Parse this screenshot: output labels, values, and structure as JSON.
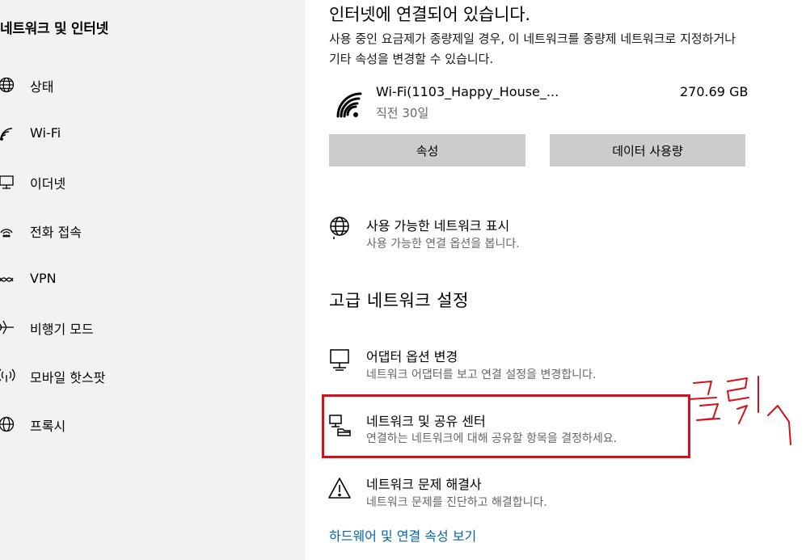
{
  "sidebar": {
    "title": "네트워크 및 인터넷",
    "items": [
      {
        "label": "상태",
        "icon": "globe-icon"
      },
      {
        "label": "Wi-Fi",
        "icon": "wifi-icon"
      },
      {
        "label": "이더넷",
        "icon": "ethernet-icon"
      },
      {
        "label": "전화 접속",
        "icon": "dialup-icon"
      },
      {
        "label": "VPN",
        "icon": "vpn-icon"
      },
      {
        "label": "비행기 모드",
        "icon": "airplane-icon"
      },
      {
        "label": "모바일 핫스팟",
        "icon": "hotspot-icon"
      },
      {
        "label": "프록시",
        "icon": "globe-icon"
      }
    ]
  },
  "status": {
    "heading": "인터넷에 연결되어 있습니다.",
    "description": "사용 중인 요금제가 종량제일 경우, 이 네트워크를 종량제 네트워크로 지정하거나 기타 속성을 변경할 수 있습니다."
  },
  "connection": {
    "name": "Wi-Fi(1103_Happy_House_...",
    "subtitle": "직전 30일",
    "usage": "270.69 GB",
    "icon": "wifi-signal-icon"
  },
  "buttons": {
    "properties": "속성",
    "data_usage": "데이터 사용량"
  },
  "available_networks": {
    "title": "사용 가능한 네트워크 표시",
    "description": "사용 가능한 연결 옵션을 봅니다.",
    "icon": "globe-icon"
  },
  "advanced": {
    "heading": "고급 네트워크 설정",
    "options": [
      {
        "title": "어댑터 옵션 변경",
        "description": "네트워크 어댑터를 보고 연결 설정을 변경합니다.",
        "icon": "monitor-icon"
      },
      {
        "title": "네트워크 및 공유 센터",
        "description": "연결하는 네트워크에 대해 공유할 항목을 결정하세요.",
        "icon": "sharing-center-icon"
      },
      {
        "title": "네트워크 문제 해결사",
        "description": "네트워크 문제를 진단하고 해결합니다.",
        "icon": "warning-icon"
      }
    ],
    "hardware_link": "하드웨어 및 연결 속성 보기"
  },
  "colors": {
    "sidebar_bg": "#f2f2f2",
    "button_bg": "#cccccc",
    "link": "#0066b4",
    "highlight": "#d4111b"
  }
}
